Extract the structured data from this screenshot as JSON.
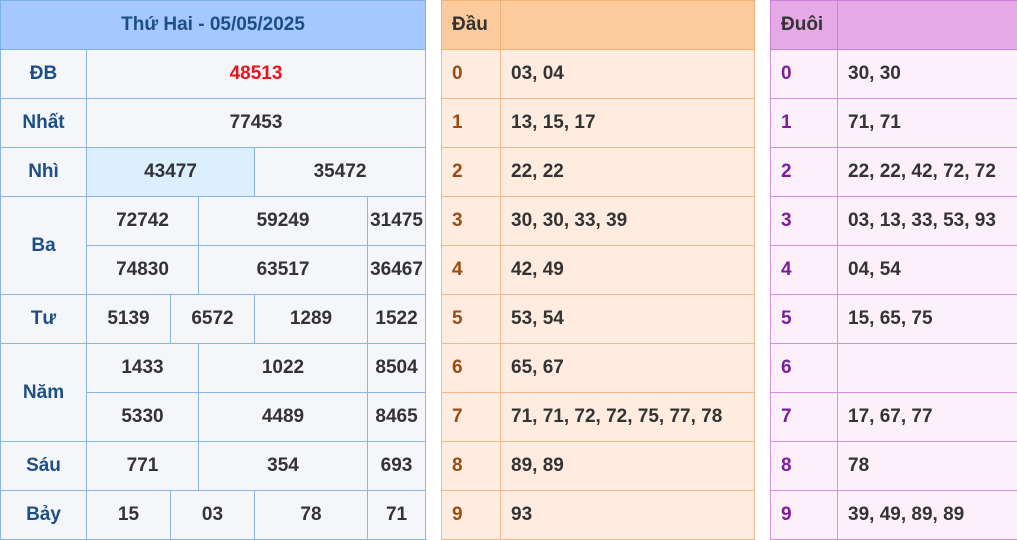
{
  "results": {
    "title": "Thứ Hai - 05/05/2025",
    "rows": [
      {
        "label": "ĐB",
        "values": [
          "48513"
        ]
      },
      {
        "label": "Nhất",
        "values": [
          "77453"
        ]
      },
      {
        "label": "Nhì",
        "values": [
          "43477",
          "35472"
        ]
      },
      {
        "label": "Ba",
        "values": [
          "72742",
          "59249",
          "31475",
          "74830",
          "63517",
          "36467"
        ]
      },
      {
        "label": "Tư",
        "values": [
          "5139",
          "6572",
          "1289",
          "1522"
        ]
      },
      {
        "label": "Năm",
        "values": [
          "1433",
          "1022",
          "8504",
          "5330",
          "4489",
          "8465"
        ]
      },
      {
        "label": "Sáu",
        "values": [
          "771",
          "354",
          "693"
        ]
      },
      {
        "label": "Bảy",
        "values": [
          "15",
          "03",
          "78",
          "71"
        ]
      }
    ]
  },
  "head": {
    "title": "Đầu",
    "rows": [
      {
        "digit": "0",
        "values": "03, 04"
      },
      {
        "digit": "1",
        "values": "13, 15, 17"
      },
      {
        "digit": "2",
        "values": "22, 22"
      },
      {
        "digit": "3",
        "values": "30, 30, 33, 39"
      },
      {
        "digit": "4",
        "values": "42, 49"
      },
      {
        "digit": "5",
        "values": "53, 54"
      },
      {
        "digit": "6",
        "values": "65, 67"
      },
      {
        "digit": "7",
        "values": "71, 71, 72, 72, 75, 77, 78"
      },
      {
        "digit": "8",
        "values": "89, 89"
      },
      {
        "digit": "9",
        "values": "93"
      }
    ]
  },
  "tail": {
    "title": "Đuôi",
    "rows": [
      {
        "digit": "0",
        "values": "30, 30"
      },
      {
        "digit": "1",
        "values": "71, 71"
      },
      {
        "digit": "2",
        "values": "22, 22, 42, 72, 72"
      },
      {
        "digit": "3",
        "values": "03, 13, 33, 53, 93"
      },
      {
        "digit": "4",
        "values": "04, 54"
      },
      {
        "digit": "5",
        "values": "15, 65, 75"
      },
      {
        "digit": "6",
        "values": ""
      },
      {
        "digit": "7",
        "values": "17, 67, 77"
      },
      {
        "digit": "8",
        "values": "78"
      },
      {
        "digit": "9",
        "values": "39, 49, 89, 89"
      }
    ]
  },
  "colors": {
    "special_prize": "#e8141b",
    "results_header": "#a4c8ff",
    "head_header": "#fccb9b",
    "tail_header": "#e4a9e6"
  }
}
